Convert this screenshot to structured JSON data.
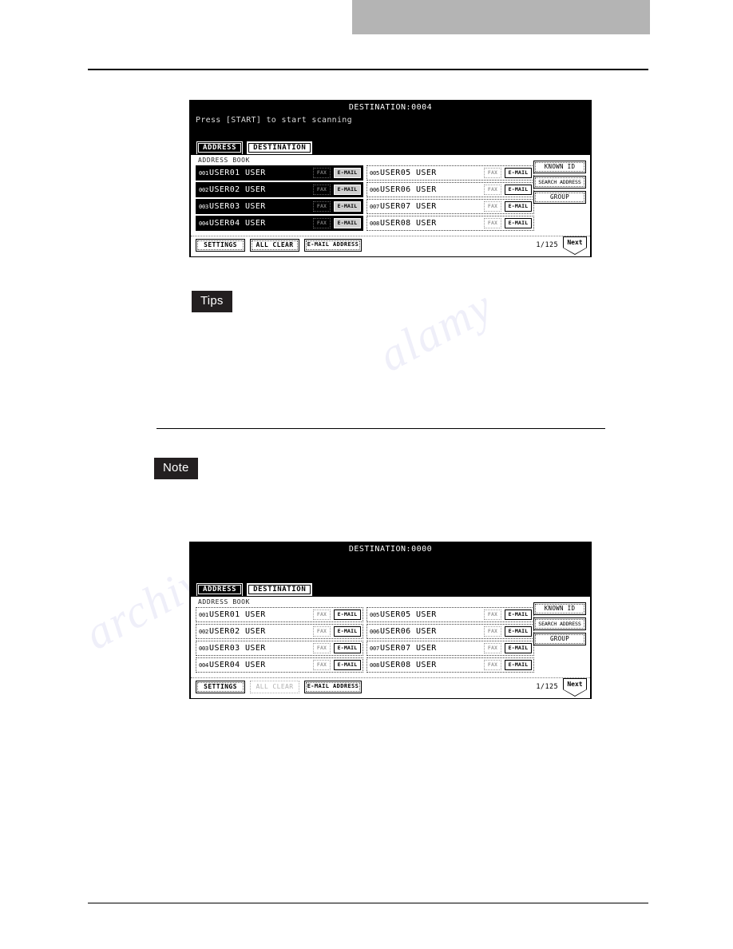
{
  "page": {
    "header_band_color": "#b4b4b4",
    "background_color": "#ffffff",
    "rule_color": "#000000"
  },
  "callouts": {
    "tips_label": "Tips",
    "note_label": "Note"
  },
  "watermark": {
    "line_a": "alamy",
    "line_b": "archive"
  },
  "panels": [
    {
      "id": "panel-top",
      "title": "DESTINATION:0004",
      "subtitle": "Press [START] to start scanning",
      "tabs": [
        {
          "label": "ADDRESS",
          "active": true
        },
        {
          "label": "DESTINATION",
          "active": false
        }
      ],
      "book_label": "ADDRESS BOOK",
      "rows_left": [
        {
          "index": "001",
          "name": "USER01 USER",
          "fax": "FAX",
          "email": "E-MAIL",
          "selected": true
        },
        {
          "index": "002",
          "name": "USER02 USER",
          "fax": "FAX",
          "email": "E-MAIL",
          "selected": true
        },
        {
          "index": "003",
          "name": "USER03 USER",
          "fax": "FAX",
          "email": "E-MAIL",
          "selected": true
        },
        {
          "index": "004",
          "name": "USER04 USER",
          "fax": "FAX",
          "email": "E-MAIL",
          "selected": true
        }
      ],
      "rows_right": [
        {
          "index": "005",
          "name": "USER05 USER",
          "fax": "FAX",
          "email": "E-MAIL",
          "selected": false
        },
        {
          "index": "006",
          "name": "USER06 USER",
          "fax": "FAX",
          "email": "E-MAIL",
          "selected": false
        },
        {
          "index": "007",
          "name": "USER07 USER",
          "fax": "FAX",
          "email": "E-MAIL",
          "selected": false
        },
        {
          "index": "008",
          "name": "USER08 USER",
          "fax": "FAX",
          "email": "E-MAIL",
          "selected": false
        }
      ],
      "side_buttons": [
        {
          "label": "KNOWN ID"
        },
        {
          "label": "SEARCH ADDRESS"
        },
        {
          "label": "GROUP"
        }
      ],
      "footer": {
        "settings": "SETTINGS",
        "all_clear": "ALL CLEAR",
        "all_clear_disabled": false,
        "email_address": "E-MAIL ADDRESS",
        "page_indicator": "1/125",
        "next": "Next"
      }
    },
    {
      "id": "panel-bottom",
      "title": "DESTINATION:0000",
      "subtitle": "",
      "tabs": [
        {
          "label": "ADDRESS",
          "active": true
        },
        {
          "label": "DESTINATION",
          "active": false
        }
      ],
      "book_label": "ADDRESS BOOK",
      "rows_left": [
        {
          "index": "001",
          "name": "USER01 USER",
          "fax": "FAX",
          "email": "E-MAIL",
          "selected": false
        },
        {
          "index": "002",
          "name": "USER02 USER",
          "fax": "FAX",
          "email": "E-MAIL",
          "selected": false
        },
        {
          "index": "003",
          "name": "USER03 USER",
          "fax": "FAX",
          "email": "E-MAIL",
          "selected": false
        },
        {
          "index": "004",
          "name": "USER04 USER",
          "fax": "FAX",
          "email": "E-MAIL",
          "selected": false
        }
      ],
      "rows_right": [
        {
          "index": "005",
          "name": "USER05 USER",
          "fax": "FAX",
          "email": "E-MAIL",
          "selected": false
        },
        {
          "index": "006",
          "name": "USER06 USER",
          "fax": "FAX",
          "email": "E-MAIL",
          "selected": false
        },
        {
          "index": "007",
          "name": "USER07 USER",
          "fax": "FAX",
          "email": "E-MAIL",
          "selected": false
        },
        {
          "index": "008",
          "name": "USER08 USER",
          "fax": "FAX",
          "email": "E-MAIL",
          "selected": false
        }
      ],
      "side_buttons": [
        {
          "label": "KNOWN ID"
        },
        {
          "label": "SEARCH ADDRESS"
        },
        {
          "label": "GROUP"
        }
      ],
      "footer": {
        "settings": "SETTINGS",
        "all_clear": "ALL CLEAR",
        "all_clear_disabled": true,
        "email_address": "E-MAIL ADDRESS",
        "page_indicator": "1/125",
        "next": "Next"
      }
    }
  ]
}
